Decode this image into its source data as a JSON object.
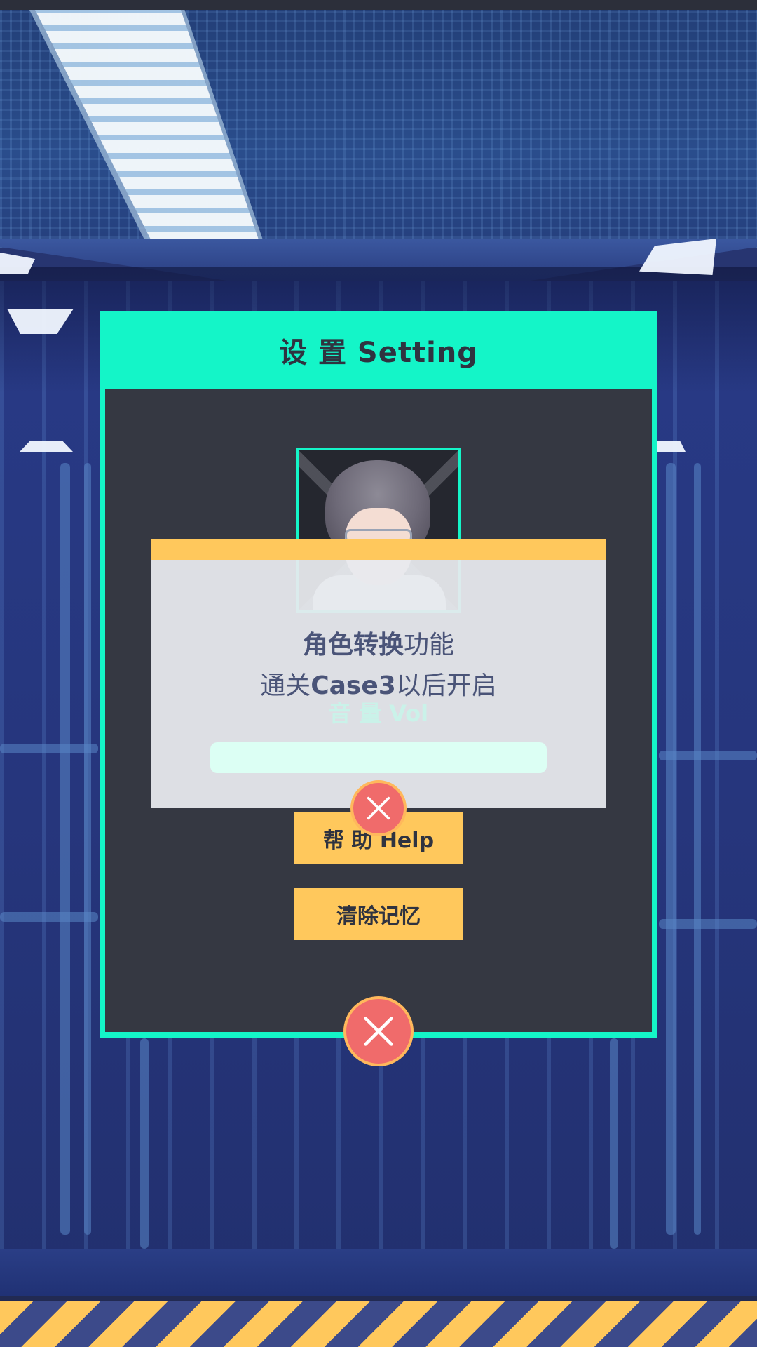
{
  "settings": {
    "title": "设 置 Setting",
    "help_label": "帮 助 Help",
    "clear_memory_label": "清除记忆"
  },
  "popup": {
    "line1_bold": "角色转换",
    "line1_rest": "功能",
    "line2_pre": "通关",
    "line2_bold": "Case3",
    "line2_post": "以后开启",
    "volume_label": "音 量 Vol"
  },
  "icons": {
    "settings_close": "close-icon",
    "popup_close": "close-icon"
  },
  "colors": {
    "accent_teal": "#14f5c8",
    "button_yellow": "#ffc85c",
    "close_red": "#f06b6b",
    "panel_dark": "#353842"
  }
}
